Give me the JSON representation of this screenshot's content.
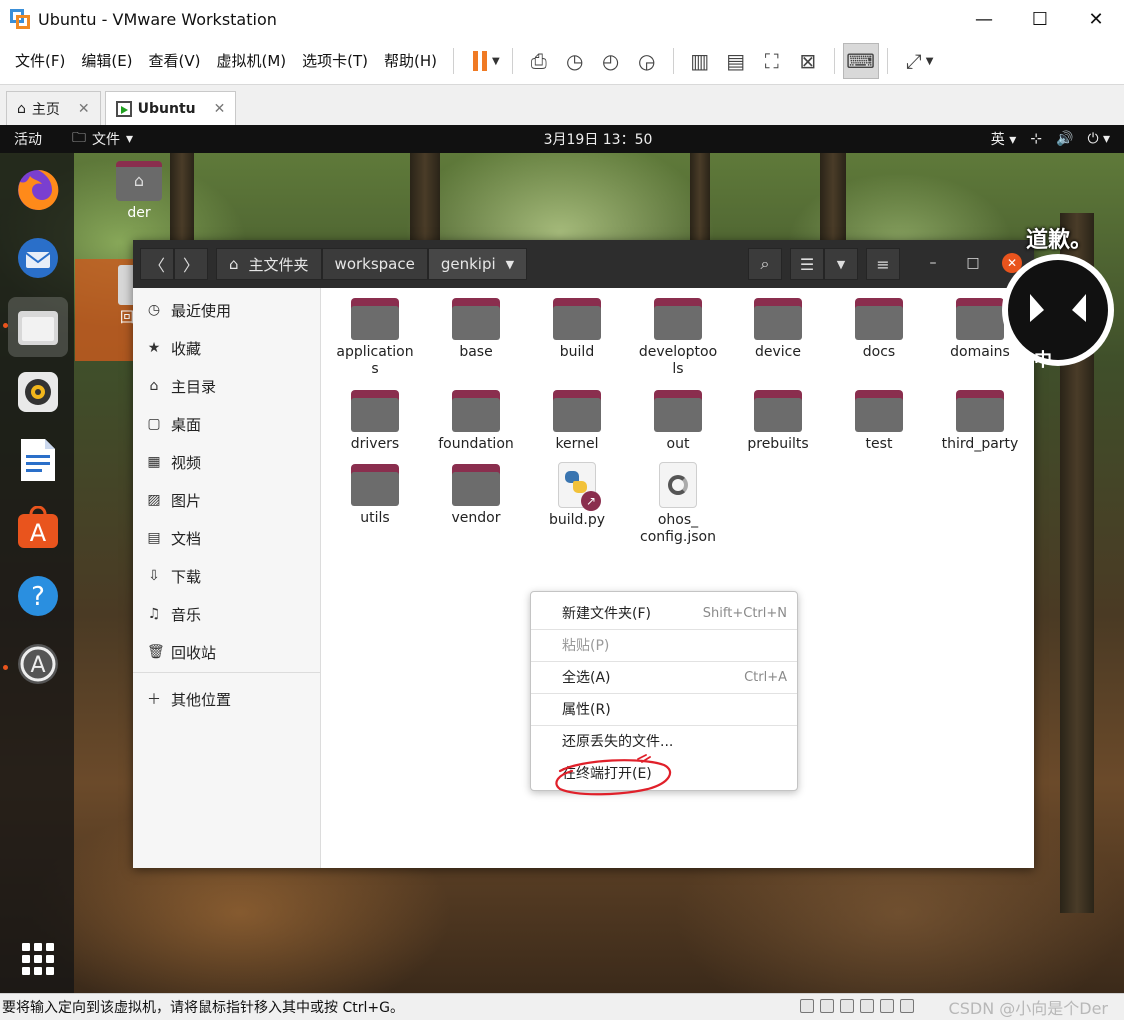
{
  "window": {
    "title": "Ubuntu  - VMware Workstation"
  },
  "menubar": {
    "items": [
      "文件(F)",
      "编辑(E)",
      "查看(V)",
      "虚拟机(M)",
      "选项卡(T)",
      "帮助(H)"
    ]
  },
  "tabs": [
    {
      "label": "主页"
    },
    {
      "label": "Ubuntu"
    }
  ],
  "guest_topbar": {
    "activities": "活动",
    "files_menu": "文件",
    "clock": "3月19日  13：50",
    "input_method": "英"
  },
  "desktop": {
    "home_icon_label": "der",
    "trash_icon_label": "回"
  },
  "nautilus": {
    "path": [
      "主文件夹",
      "workspace",
      "genkipi"
    ],
    "sidebar": [
      {
        "label": "最近使用",
        "icon": "clock-icon"
      },
      {
        "label": "收藏",
        "icon": "star-icon"
      },
      {
        "label": "主目录",
        "icon": "home-icon"
      },
      {
        "label": "桌面",
        "icon": "desktop-icon"
      },
      {
        "label": "视频",
        "icon": "video-icon"
      },
      {
        "label": "图片",
        "icon": "picture-icon"
      },
      {
        "label": "文档",
        "icon": "document-icon"
      },
      {
        "label": "下载",
        "icon": "download-icon"
      },
      {
        "label": "音乐",
        "icon": "music-icon"
      },
      {
        "label": "回收站",
        "icon": "trash-icon"
      }
    ],
    "other_locations": "其他位置",
    "files": [
      {
        "name": "application\ns",
        "type": "folder"
      },
      {
        "name": "base",
        "type": "folder"
      },
      {
        "name": "build",
        "type": "folder"
      },
      {
        "name": "developtoo\nls",
        "type": "folder"
      },
      {
        "name": "device",
        "type": "folder"
      },
      {
        "name": "docs",
        "type": "folder"
      },
      {
        "name": "domains",
        "type": "folder"
      },
      {
        "name": "drivers",
        "type": "folder"
      },
      {
        "name": "foundation",
        "type": "folder"
      },
      {
        "name": "kernel",
        "type": "folder"
      },
      {
        "name": "out",
        "type": "folder"
      },
      {
        "name": "prebuilts",
        "type": "folder"
      },
      {
        "name": "test",
        "type": "folder"
      },
      {
        "name": "third_party",
        "type": "folder"
      },
      {
        "name": "utils",
        "type": "folder"
      },
      {
        "name": "vendor",
        "type": "folder"
      },
      {
        "name": "build.py",
        "type": "python-link"
      },
      {
        "name": "ohos_\nconfig.json",
        "type": "json"
      }
    ]
  },
  "context_menu": {
    "items": [
      {
        "label": "新建文件夹(F)",
        "accel": "Shift+Ctrl+N",
        "disabled": false
      },
      {
        "label": "粘贴(P)",
        "accel": "",
        "disabled": true
      },
      {
        "label": "全选(A)",
        "accel": "Ctrl+A",
        "disabled": false
      },
      {
        "label": "属性(R)",
        "accel": "",
        "disabled": false
      },
      {
        "label": "还原丢失的文件...",
        "accel": "",
        "disabled": false
      },
      {
        "label": "在终端打开(E)",
        "accel": "",
        "disabled": false
      }
    ]
  },
  "sticker_text": "道歉。",
  "sticker_badge": "中",
  "statusbar": {
    "message": "要将输入定向到该虚拟机，请将鼠标指针移入其中或按 Ctrl+G。",
    "watermark": "CSDN @小向是个Der"
  },
  "colors": {
    "accent_orange": "#e9541d",
    "folder_tab": "#8a2e4e",
    "header_dark": "#2d2d2d",
    "annotation_red": "#e0202a"
  }
}
